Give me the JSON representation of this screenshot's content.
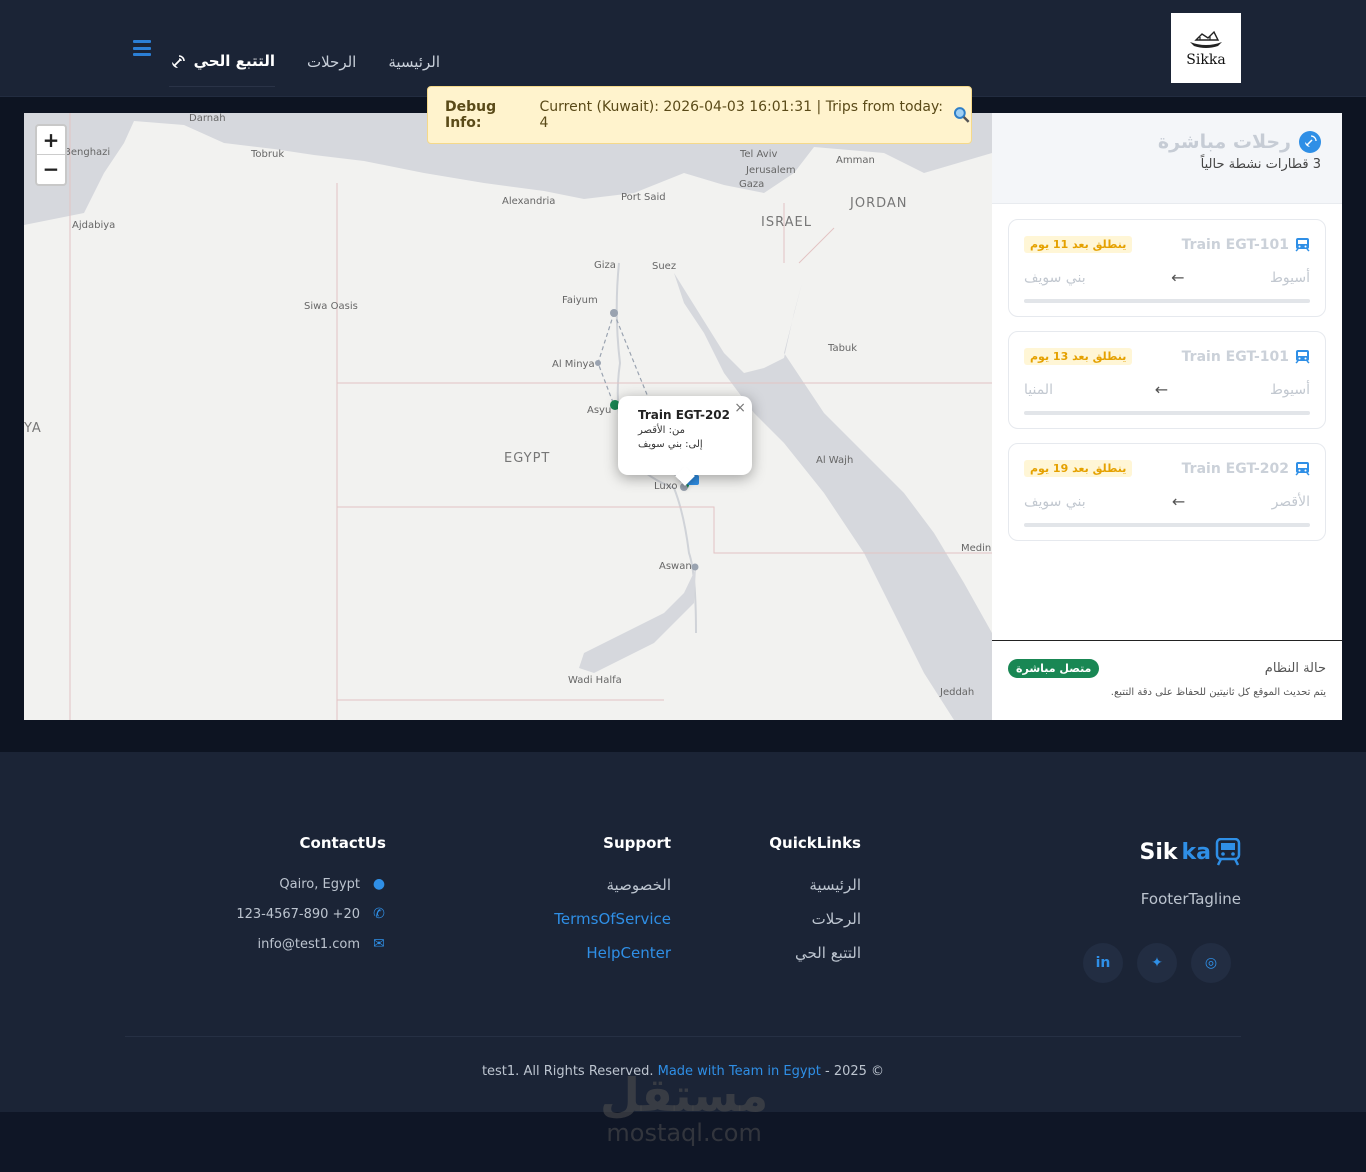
{
  "nav": {
    "logo_text": "Sikka",
    "items": [
      {
        "label": "الرئيسية"
      },
      {
        "label": "الرحلات"
      },
      {
        "label": "التتبع الحي"
      }
    ]
  },
  "debug": {
    "label": "Debug Info:",
    "text": "Current (Kuwait): 2026-04-03 16:01:31 | Trips from today: 4",
    "icon": "magnifier-icon"
  },
  "map": {
    "zoom_in": "+",
    "zoom_out": "−",
    "labels": {
      "darnah": "Darnah",
      "benghazi": "Benghazi",
      "tobruk": "Tobruk",
      "ajdabiya": "Ajdabiya",
      "alexandria": "Alexandria",
      "port_said": "Port Said",
      "tel_aviv": "Tel Aviv",
      "amman": "Amman",
      "jerusalem": "Jerusalem",
      "gaza": "Gaza",
      "israel": "ISRAEL",
      "jordan": "JORDAN",
      "giza": "Giza",
      "suez": "Suez",
      "faiyum": "Faiyum",
      "siwa": "Siwa Oasis",
      "al_minya": "Al Minya",
      "tabuk": "Tabuk",
      "asyut": "Asyu",
      "egypt": "EGYPT",
      "libya": "YA",
      "luxor": "Luxo",
      "al_wajh": "Al Wajh",
      "aswan": "Aswan",
      "medina": "Medin",
      "wadi_halfa": "Wadi Halfa",
      "jeddah": "Jeddah"
    },
    "popup": {
      "title": "Train EGT-202",
      "from": "من: الأقصر",
      "to": "إلى: بني سويف",
      "close": "×"
    }
  },
  "sidebar": {
    "title": "رحلات مباشرة",
    "subtitle": "3 قطارات نشطة حالياً",
    "trips": [
      {
        "train": "Train EGT-101",
        "countdown": "ينطلق بعد 11 يوم",
        "from": "أسيوط",
        "to": "بني سويف",
        "progress": 0
      },
      {
        "train": "Train EGT-101",
        "countdown": "ينطلق بعد 13 يوم",
        "from": "أسيوط",
        "to": "المنيا",
        "progress": 0
      },
      {
        "train": "Train EGT-202",
        "countdown": "ينطلق بعد 19 يوم",
        "from": "الأقصر",
        "to": "بني سويف",
        "progress": 0
      }
    ],
    "arrow": "←",
    "status_label": "حالة النظام",
    "status_badge": "متصل مباشرة",
    "status_note": "يتم تحديث الموقع كل ثانيتين للحفاظ على دقة التتبع.",
    "colors": {
      "badge": "#198754",
      "countdown": "#e5a100"
    }
  },
  "footer": {
    "brand_a": "Sik",
    "brand_b": "ka",
    "tagline": "FooterTagline",
    "socials": [
      {
        "icon": "instagram-icon",
        "glyph": "◎"
      },
      {
        "icon": "twitter-icon",
        "glyph": "✦"
      },
      {
        "icon": "linkedin-icon",
        "glyph": "in"
      }
    ],
    "quicklinks": {
      "title": "QuickLinks",
      "links": [
        "الرئيسية",
        "الرحلات",
        "التتبع الحي"
      ]
    },
    "support": {
      "title": "Support",
      "links": [
        "الخصوصية",
        "TermsOfService",
        "HelpCenter"
      ]
    },
    "contact": {
      "title": "ContactUs",
      "address": "Qairo, Egypt",
      "phone": "20+ 123-4567-890",
      "email": "info@test1.com"
    },
    "copyright_pre": "test1. All Rights Reserved.",
    "copyright_link": "Made with Team in Egypt",
    "copyright_post": "- 2025 ©"
  },
  "watermark": {
    "ar": "مستقل",
    "en": "mostaql.com"
  },
  "colors": {
    "accent": "#2f8fe6",
    "nav_bg": "#1b2436",
    "page_bg": "#0d1422"
  }
}
